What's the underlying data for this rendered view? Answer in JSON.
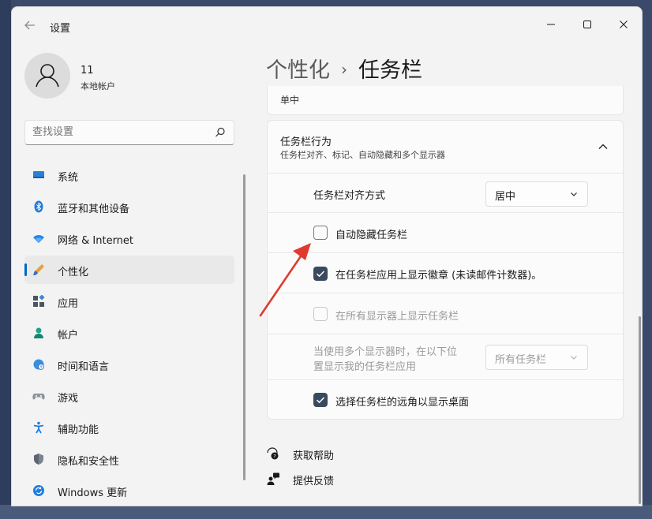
{
  "window": {
    "title": "设置",
    "back_icon": "back-arrow-icon"
  },
  "user": {
    "name": "11",
    "account_type": "本地帐户"
  },
  "search": {
    "placeholder": "查找设置"
  },
  "sidebar": {
    "items": [
      {
        "label": "系统",
        "icon": "monitor-icon",
        "active": false
      },
      {
        "label": "蓝牙和其他设备",
        "icon": "bluetooth-icon",
        "active": false
      },
      {
        "label": "网络 & Internet",
        "icon": "wifi-icon",
        "active": false
      },
      {
        "label": "个性化",
        "icon": "brush-icon",
        "active": true
      },
      {
        "label": "应用",
        "icon": "apps-icon",
        "active": false
      },
      {
        "label": "帐户",
        "icon": "person-icon",
        "active": false
      },
      {
        "label": "时间和语言",
        "icon": "globe-clock-icon",
        "active": false
      },
      {
        "label": "游戏",
        "icon": "gamepad-icon",
        "active": false
      },
      {
        "label": "辅助功能",
        "icon": "accessibility-icon",
        "active": false
      },
      {
        "label": "隐私和安全性",
        "icon": "shield-icon",
        "active": false
      },
      {
        "label": "Windows 更新",
        "icon": "update-icon",
        "active": false
      }
    ]
  },
  "breadcrumb": {
    "parent": "个性化",
    "separator": "›",
    "current": "任务栏"
  },
  "prev_card": {
    "text": "单中"
  },
  "behaviors": {
    "title": "任务栏行为",
    "subtitle": "任务栏对齐、标记、自动隐藏和多个显示器",
    "alignment": {
      "label": "任务栏对齐方式",
      "value": "居中"
    },
    "auto_hide": {
      "label": "自动隐藏任务栏",
      "checked": false
    },
    "badges": {
      "label": "在任务栏应用上显示徽章 (未读邮件计数器)。",
      "checked": true
    },
    "all_displays": {
      "label": "在所有显示器上显示任务栏",
      "checked": false,
      "disabled": true
    },
    "multi_display": {
      "label_line1": "当使用多个显示器时，在以下位",
      "label_line2": "置显示我的任务栏应用",
      "value": "所有任务栏",
      "disabled": true
    },
    "far_corner": {
      "label": "选择任务栏的远角以显示桌面",
      "checked": true
    }
  },
  "help": {
    "get_help": "获取帮助",
    "feedback": "提供反馈"
  },
  "colors": {
    "accent": "#0067c0",
    "checkbox_checked": "#3a4a5e",
    "arrow": "#e03a2f"
  }
}
